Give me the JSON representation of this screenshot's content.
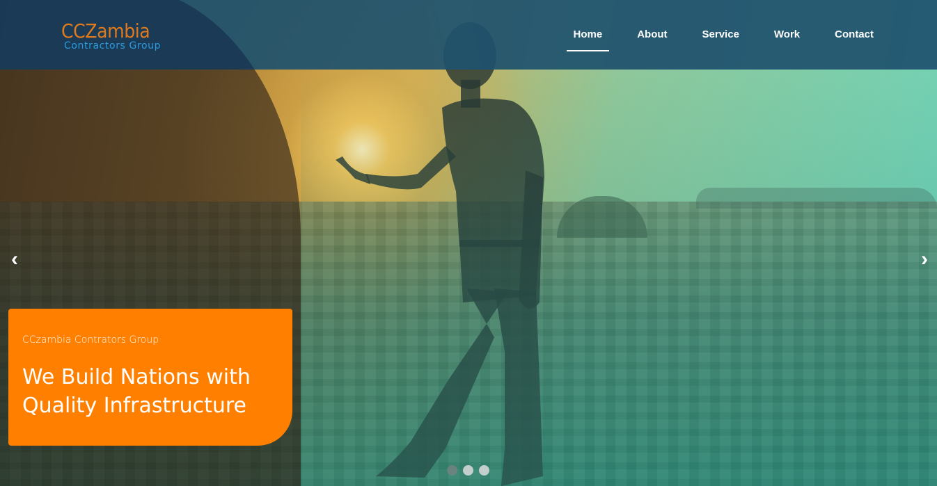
{
  "brand": {
    "name": "CCZambia",
    "tagline": "Contractors Group",
    "name_color": "#e07a1f",
    "tagline_color": "#2a9be0"
  },
  "nav": {
    "items": [
      {
        "label": "Home",
        "active": true
      },
      {
        "label": "About",
        "active": false
      },
      {
        "label": "Service",
        "active": false
      },
      {
        "label": "Work",
        "active": false
      },
      {
        "label": "Contact",
        "active": false
      }
    ]
  },
  "slider": {
    "prev_icon": "‹",
    "next_icon": "›",
    "slide_count": 3,
    "active_slide": 1,
    "caption": {
      "subtitle": "CCzambia Contrators Group",
      "headline": "We Build Nations with Quality Infrastructure",
      "background_color": "#ff8000"
    }
  },
  "colors": {
    "header": "#1f526e",
    "accent": "#ff8000"
  }
}
